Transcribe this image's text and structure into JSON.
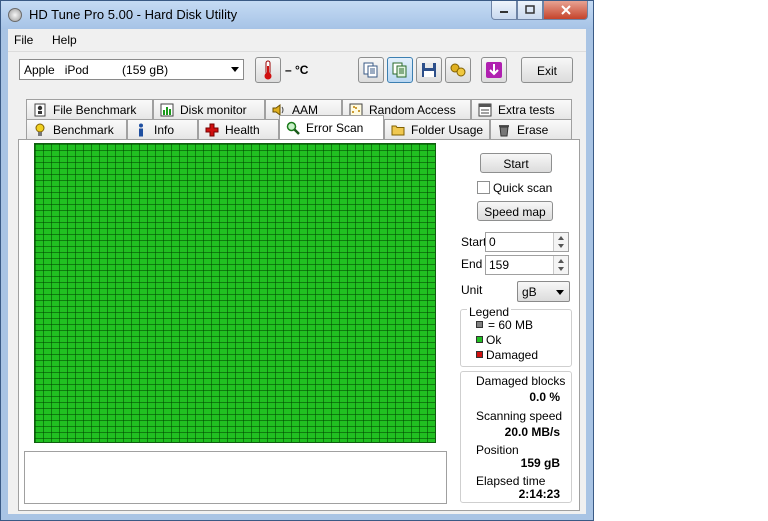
{
  "window": {
    "title": "HD Tune Pro 5.00 - Hard Disk Utility"
  },
  "menu": {
    "file": "File",
    "help": "Help"
  },
  "toolbar": {
    "drive": "Apple   iPod          (159 gB)",
    "temperature": "– °C",
    "exit_label": "Exit"
  },
  "tabs_top": [
    "File Benchmark",
    "Disk monitor",
    "AAM",
    "Random Access",
    "Extra tests"
  ],
  "tabs_bottom": [
    "Benchmark",
    "Info",
    "Health",
    "Error Scan",
    "Folder Usage",
    "Erase"
  ],
  "controls": {
    "start_button": "Start",
    "quick_scan": "Quick scan",
    "speed_map_button": "Speed map",
    "start_label": "Start",
    "start_value": "0",
    "end_label": "End",
    "end_value": "159",
    "unit_label": "Unit",
    "unit_value": "gB"
  },
  "legend": {
    "title": "Legend",
    "block_size": "= 60 MB",
    "ok": "Ok",
    "damaged": "Damaged",
    "colors": {
      "block": "#808080",
      "ok": "#21c021",
      "damaged": "#d01010"
    }
  },
  "stats": {
    "damaged_blocks_label": "Damaged blocks",
    "damaged_blocks_value": "0.0 %",
    "scanning_speed_label": "Scanning speed",
    "scanning_speed_value": "20.0 MB/s",
    "position_label": "Position",
    "position_value": "159 gB",
    "elapsed_time_label": "Elapsed time",
    "elapsed_time_value": "2:14:23"
  }
}
